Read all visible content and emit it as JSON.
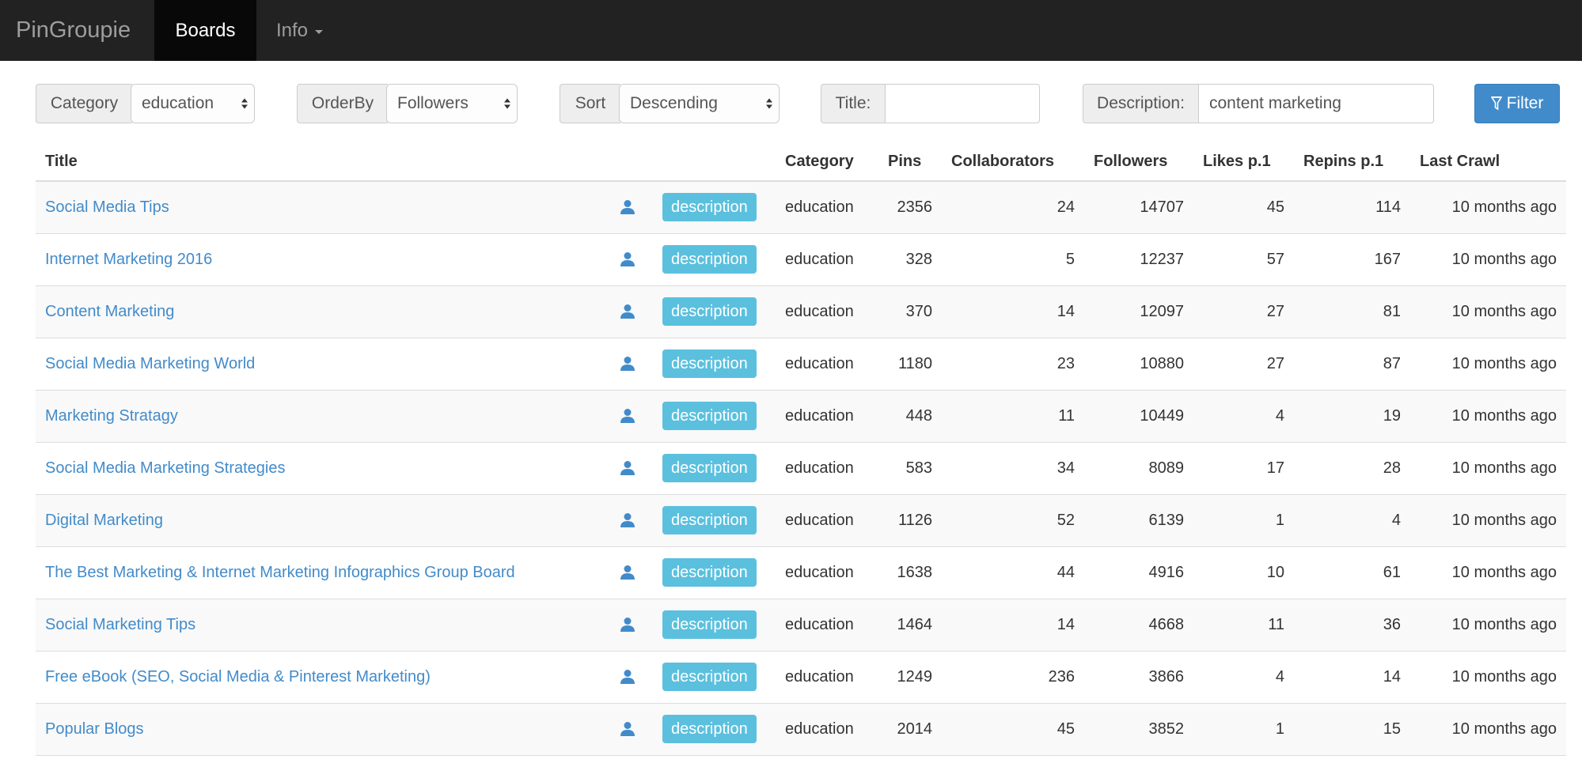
{
  "nav": {
    "brand": "PinGroupie",
    "boards": "Boards",
    "info": "Info"
  },
  "filters": {
    "category_label": "Category",
    "category_value": "education",
    "orderby_label": "OrderBy",
    "orderby_value": "Followers",
    "sort_label": "Sort",
    "sort_value": "Descending",
    "title_label": "Title:",
    "title_value": "",
    "description_label": "Description:",
    "description_value": "content marketing",
    "filter_button": "Filter"
  },
  "table": {
    "headers": [
      "Title",
      "",
      "",
      "Category",
      "Pins",
      "Collaborators",
      "Followers",
      "Likes p.1",
      "Repins p.1",
      "Last Crawl"
    ],
    "description_label": "description",
    "rows": [
      {
        "title": "Social Media Tips",
        "category": "education",
        "pins": "2356",
        "collaborators": "24",
        "followers": "14707",
        "likes": "45",
        "repins": "114",
        "last_crawl": "10 months ago"
      },
      {
        "title": "Internet Marketing 2016",
        "category": "education",
        "pins": "328",
        "collaborators": "5",
        "followers": "12237",
        "likes": "57",
        "repins": "167",
        "last_crawl": "10 months ago"
      },
      {
        "title": "Content Marketing",
        "category": "education",
        "pins": "370",
        "collaborators": "14",
        "followers": "12097",
        "likes": "27",
        "repins": "81",
        "last_crawl": "10 months ago"
      },
      {
        "title": "Social Media Marketing World",
        "category": "education",
        "pins": "1180",
        "collaborators": "23",
        "followers": "10880",
        "likes": "27",
        "repins": "87",
        "last_crawl": "10 months ago"
      },
      {
        "title": "Marketing Stratagy",
        "category": "education",
        "pins": "448",
        "collaborators": "11",
        "followers": "10449",
        "likes": "4",
        "repins": "19",
        "last_crawl": "10 months ago"
      },
      {
        "title": "Social Media Marketing Strategies",
        "category": "education",
        "pins": "583",
        "collaborators": "34",
        "followers": "8089",
        "likes": "17",
        "repins": "28",
        "last_crawl": "10 months ago"
      },
      {
        "title": "Digital Marketing",
        "category": "education",
        "pins": "1126",
        "collaborators": "52",
        "followers": "6139",
        "likes": "1",
        "repins": "4",
        "last_crawl": "10 months ago"
      },
      {
        "title": "The Best Marketing & Internet Marketing Infographics Group Board",
        "category": "education",
        "pins": "1638",
        "collaborators": "44",
        "followers": "4916",
        "likes": "10",
        "repins": "61",
        "last_crawl": "10 months ago"
      },
      {
        "title": "Social Marketing Tips",
        "category": "education",
        "pins": "1464",
        "collaborators": "14",
        "followers": "4668",
        "likes": "11",
        "repins": "36",
        "last_crawl": "10 months ago"
      },
      {
        "title": "Free eBook (SEO, Social Media & Pinterest Marketing)",
        "category": "education",
        "pins": "1249",
        "collaborators": "236",
        "followers": "3866",
        "likes": "4",
        "repins": "14",
        "last_crawl": "10 months ago"
      },
      {
        "title": "Popular Blogs",
        "category": "education",
        "pins": "2014",
        "collaborators": "45",
        "followers": "3852",
        "likes": "1",
        "repins": "15",
        "last_crawl": "10 months ago"
      }
    ]
  },
  "colors": {
    "navbar": "#222222",
    "link": "#428bca",
    "label_info": "#5bc0de",
    "primary": "#428bca"
  }
}
